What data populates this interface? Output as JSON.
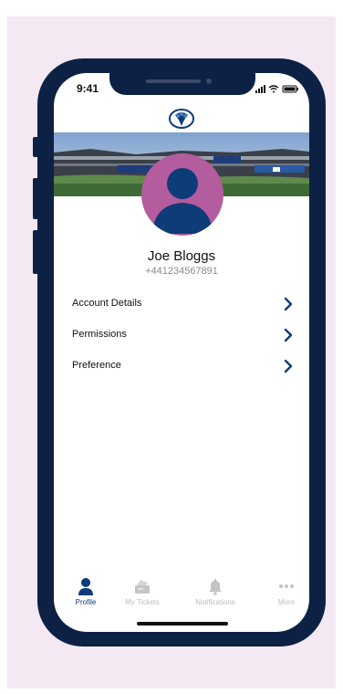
{
  "status": {
    "time": "9:41"
  },
  "profile": {
    "name": "Joe Bloggs",
    "phone": "+441234567891"
  },
  "menu": [
    {
      "label": "Account Details"
    },
    {
      "label": "Permissions"
    },
    {
      "label": "Preference"
    }
  ],
  "tabs": [
    {
      "label": "Profile",
      "icon": "person-icon",
      "active": true
    },
    {
      "label": "My Tickets",
      "icon": "tickets-icon",
      "active": false
    },
    {
      "label": "Notifications",
      "icon": "bell-icon",
      "active": false
    },
    {
      "label": "More",
      "icon": "ellipsis-icon",
      "active": false
    }
  ],
  "colors": {
    "navy": "#0d2144",
    "accent": "#0d3c78",
    "avatar_bg": "#b35c9e",
    "backdrop": "#f4e9f3"
  }
}
